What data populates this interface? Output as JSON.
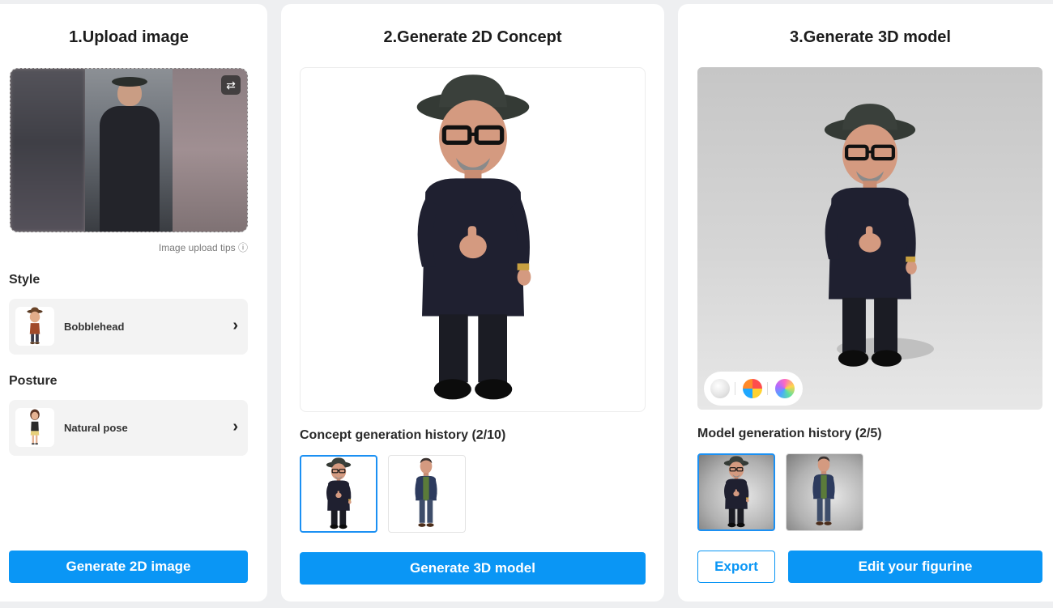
{
  "step1": {
    "title": "1.Upload image",
    "upload_tips": "Image upload tips ⓘ",
    "swap_icon": "swap-icon",
    "style_label": "Style",
    "style_value": "Bobblehead",
    "posture_label": "Posture",
    "posture_value": "Natural pose",
    "chevron": "›",
    "button": "Generate 2D image"
  },
  "step2": {
    "title": "2.Generate 2D Concept",
    "history_label": "Concept generation history (2/10)",
    "button": "Generate 3D model"
  },
  "step3": {
    "title": "3.Generate 3D model",
    "history_label": "Model generation history (2/5)",
    "export_button": "Export",
    "edit_button": "Edit your figurine",
    "materials": [
      "plain-white-material",
      "multicolor-material",
      "iridescent-material"
    ]
  },
  "colors": {
    "accent": "#0a96f5",
    "panel_bg": "#ffffff",
    "page_bg": "#eeeff1",
    "selected_border": "#1b90f3"
  }
}
